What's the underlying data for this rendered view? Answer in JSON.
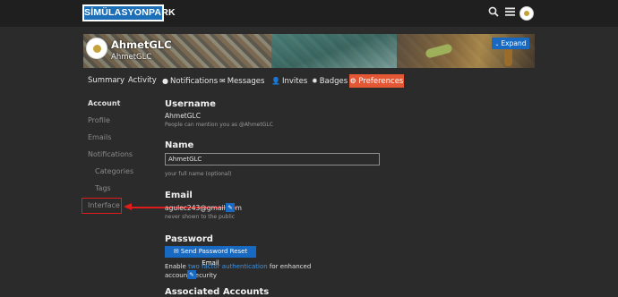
{
  "header": {
    "logo_text": "SİMÜLASYONPARK",
    "icons": [
      "search-icon",
      "hamburger-menu-icon",
      "user-avatar"
    ]
  },
  "banner": {
    "username": "AhmetGLC",
    "display_name": "AhmetGLC",
    "expand_label": "Expand"
  },
  "tabs": [
    {
      "label": "Summary",
      "icon": ""
    },
    {
      "label": "Activity",
      "icon": ""
    },
    {
      "label": "Notifications",
      "icon": "chat-bubble-icon"
    },
    {
      "label": "Messages",
      "icon": "envelope-icon"
    },
    {
      "label": "Invites",
      "icon": "user-plus-icon"
    },
    {
      "label": "Badges",
      "icon": "certificate-icon"
    },
    {
      "label": "Preferences",
      "icon": "gear-icon",
      "active": true
    }
  ],
  "sidebar": {
    "items": [
      {
        "label": "Account",
        "active": true
      },
      {
        "label": "Profile"
      },
      {
        "label": "Emails"
      },
      {
        "label": "Notifications"
      },
      {
        "label": "Categories",
        "sub": true
      },
      {
        "label": "Tags",
        "sub": true
      },
      {
        "label": "Interface",
        "highlighted": true
      }
    ]
  },
  "content": {
    "username": {
      "title": "Username",
      "value": "AhmetGLC",
      "hint": "People can mention you as @AhmetGLC"
    },
    "name": {
      "title": "Name",
      "value": "AhmetGLC",
      "hint": "your full name (optional)"
    },
    "email": {
      "title": "Email",
      "value": "agulec243@gmail.com",
      "hint": "never shown to the public"
    },
    "password": {
      "title": "Password",
      "reset_button": "Send Password Reset Email",
      "enable_prefix": "Enable ",
      "enable_link": "two factor authentication",
      "enable_suffix": " for enhanced account security"
    },
    "associated": {
      "title": "Associated Accounts"
    }
  },
  "colors": {
    "accent": "#e45735",
    "primary_button": "#1769c2",
    "annotation": "#e01b1b",
    "background": "#2b2b2b"
  }
}
